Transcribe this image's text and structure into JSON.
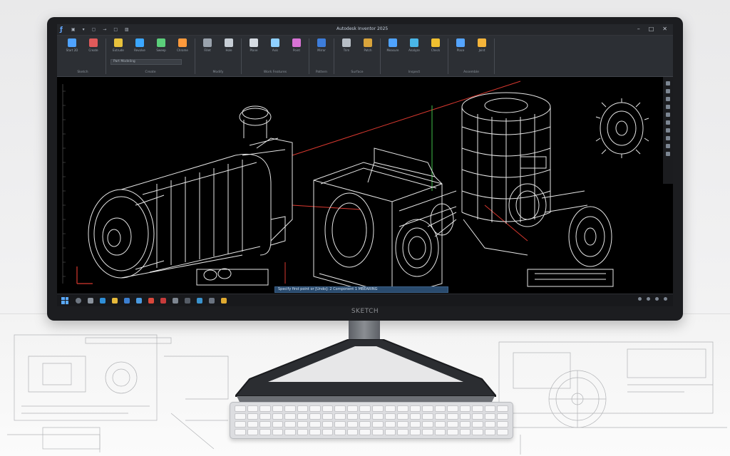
{
  "app": {
    "logo_glyph": "ƒ",
    "menu": [
      "▣",
      "▾",
      "▢",
      "→",
      "□",
      "▨"
    ],
    "document_title": "Autodesk Inventor 2025",
    "window_controls": [
      "–",
      "□",
      "✕"
    ]
  },
  "ribbon": {
    "groups": [
      {
        "name": "Sketch",
        "tools": [
          "Start 2D",
          "Create"
        ],
        "colors": [
          "#4fa3ff",
          "#e05a5a"
        ]
      },
      {
        "name": "Create",
        "tools": [
          "Extrude",
          "Revolve",
          "Sweep",
          "Chrome"
        ],
        "colors": [
          "#e8c23c",
          "#3ba7ff",
          "#5bcf7a",
          "#ff9a3c"
        ],
        "dropdown": "Part Modeling"
      },
      {
        "name": "Modify",
        "tools": [
          "Fillet",
          "Hole"
        ],
        "colors": [
          "#9aa3ad",
          "#c7ced6"
        ]
      },
      {
        "name": "Work Features",
        "tools": [
          "Plane",
          "Axis",
          "Point"
        ],
        "colors": [
          "#d5dbe2",
          "#8fd0ff",
          "#d873d6"
        ]
      },
      {
        "name": "Pattern",
        "tools": [
          "Mirror"
        ],
        "colors": [
          "#3d7ddb"
        ]
      },
      {
        "name": "Surface",
        "tools": [
          "Trim",
          "Patch"
        ],
        "colors": [
          "#b7bec6",
          "#d9a43b"
        ]
      },
      {
        "name": "Inspect",
        "tools": [
          "Measure",
          "Analyze",
          "Check"
        ],
        "colors": [
          "#4fa3ff",
          "#49b6e8",
          "#f0c030"
        ]
      },
      {
        "name": "Assemble",
        "tools": [
          "Place",
          "Joint"
        ],
        "colors": [
          "#55a5ff",
          "#f4b43a"
        ]
      }
    ]
  },
  "command_line": "Specify first point or [Undo]: 2 Component 1 MBEARING",
  "brand": "SKETCH",
  "colors": {
    "accent": "#4fa3ff",
    "wireframe": "#e6e6e6",
    "red_axis": "#d7382f",
    "green_axis": "#3fbf4a"
  }
}
